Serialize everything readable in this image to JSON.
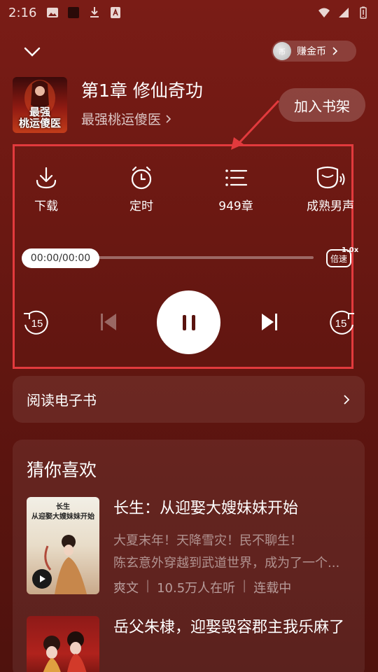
{
  "status": {
    "time": "2:16"
  },
  "header": {
    "earn_label": "赚金币",
    "coin_glyph": "币"
  },
  "book": {
    "chapter_title": "第1章 修仙奇功",
    "book_name": "最强桃运傻医",
    "cover_text_line1": "最强",
    "cover_text_line2": "桃运傻医"
  },
  "shelf_button": "加入书架",
  "tools": [
    {
      "label": "下载",
      "icon": "download-icon"
    },
    {
      "label": "定时",
      "icon": "alarm-clock-icon"
    },
    {
      "label": "949章",
      "icon": "chapter-list-icon"
    },
    {
      "label": "成熟男声",
      "icon": "voice-icon"
    }
  ],
  "player": {
    "time": "00:00/00:00",
    "progress": 0,
    "speed_label": "倍速",
    "speed_value": "1.0x",
    "rewind_label": "15",
    "forward_label": "15"
  },
  "read_ebook": "阅读电子书",
  "recommend": {
    "title": "猜你喜欢",
    "items": [
      {
        "title": "长生：从迎娶大嫂妹妹开始",
        "desc1": "大夏末年！天降雪灾！民不聊生！",
        "desc2": "陈玄意外穿越到武道世界，成为了一个...",
        "narrator": "爽文",
        "listeners": "10.5万人在听",
        "state": "连载中",
        "cover_line1": "长生",
        "cover_line2": "从迎娶大嫂妹妹开始"
      },
      {
        "title": "岳父朱棣，迎娶毁容郡主我乐麻了"
      }
    ]
  }
}
